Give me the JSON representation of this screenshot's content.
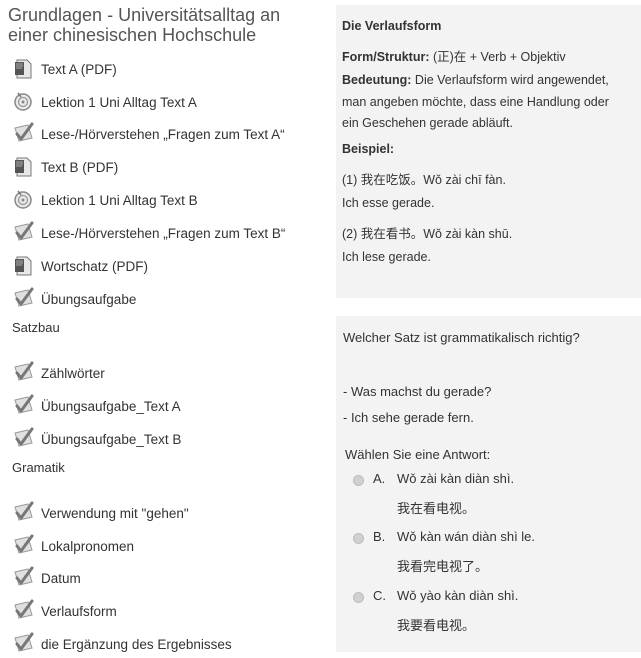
{
  "course": {
    "title": "Grundlagen - Universitätsalltag an einer chinesischen Hochschule"
  },
  "activities": [
    {
      "icon": "pdf-icon",
      "label": "Text A (PDF)"
    },
    {
      "icon": "audio-icon",
      "label": "Lektion 1 Uni Alltag Text A"
    },
    {
      "icon": "quiz-check-icon",
      "label": "Lese-/Hörverstehen „Fragen zum Text A“"
    },
    {
      "icon": "pdf-icon",
      "label": "Text B (PDF)"
    },
    {
      "icon": "audio-icon",
      "label": "Lektion 1 Uni Alltag Text B"
    },
    {
      "icon": "quiz-check-icon",
      "label": "Lese-/Hörverstehen „Fragen zum Text B“"
    },
    {
      "icon": "pdf-icon",
      "label": "Wortschatz (PDF)"
    },
    {
      "icon": "quiz-check-icon",
      "label": "Übungsaufgabe"
    }
  ],
  "section_satzbau": {
    "title": "Satzbau",
    "items": [
      {
        "icon": "quiz-check-icon",
        "label": "Zählwörter"
      },
      {
        "icon": "quiz-check-icon",
        "label": "Übungsaufgabe_Text A"
      },
      {
        "icon": "quiz-check-icon",
        "label": "Übungsaufgabe_Text B"
      }
    ]
  },
  "section_gramatik": {
    "title": "Gramatik",
    "items": [
      {
        "icon": "quiz-check-icon",
        "label": "Verwendung mit \"gehen\""
      },
      {
        "icon": "quiz-check-icon",
        "label": "Lokalpronomen"
      },
      {
        "icon": "quiz-check-icon",
        "label": "Datum"
      },
      {
        "icon": "quiz-check-icon",
        "label": "Verlaufsform"
      },
      {
        "icon": "quiz-check-icon",
        "label": "die Ergänzung des Ergebnisses"
      }
    ]
  },
  "grammar_card": {
    "title": "Die Verlaufsform",
    "form_label": "Form/Struktur:",
    "form_value": "(正)在 + Verb + Objektiv",
    "meaning_label": "Bedeutung:",
    "meaning_line1": "Die Verlaufsform wird angewendet,",
    "meaning_line2": "man angeben möchte, dass eine Handlung oder",
    "meaning_line3": "ein Geschehen gerade abläuft.",
    "example_label": "Beispiel:",
    "ex1": "(1) 我在吃饭。Wǒ zài chī fàn.",
    "ex1_de": "Ich esse gerade.",
    "ex2": "(2) 我在看书。Wǒ zài kàn shū.",
    "ex2_de": "Ich lese gerade."
  },
  "quiz_card": {
    "question": "Welcher Satz ist grammatikalisch richtig?",
    "dialog1": "- Was machst du gerade?",
    "dialog2": "- Ich sehe gerade fern.",
    "prompt": "Wählen Sie eine Antwort:",
    "options": [
      {
        "letter": "A.",
        "pinyin": "Wǒ zài kàn diàn shì.",
        "hanzi": "我在看电视。"
      },
      {
        "letter": "B.",
        "pinyin": "Wǒ kàn wán diàn shì le.",
        "hanzi": "我看完电视了。"
      },
      {
        "letter": "C.",
        "pinyin": "Wǒ yào kàn diàn shì.",
        "hanzi": "我要看电视。"
      }
    ]
  },
  "colors": {
    "card_bg": "#f3f3f3",
    "text": "#333333"
  }
}
